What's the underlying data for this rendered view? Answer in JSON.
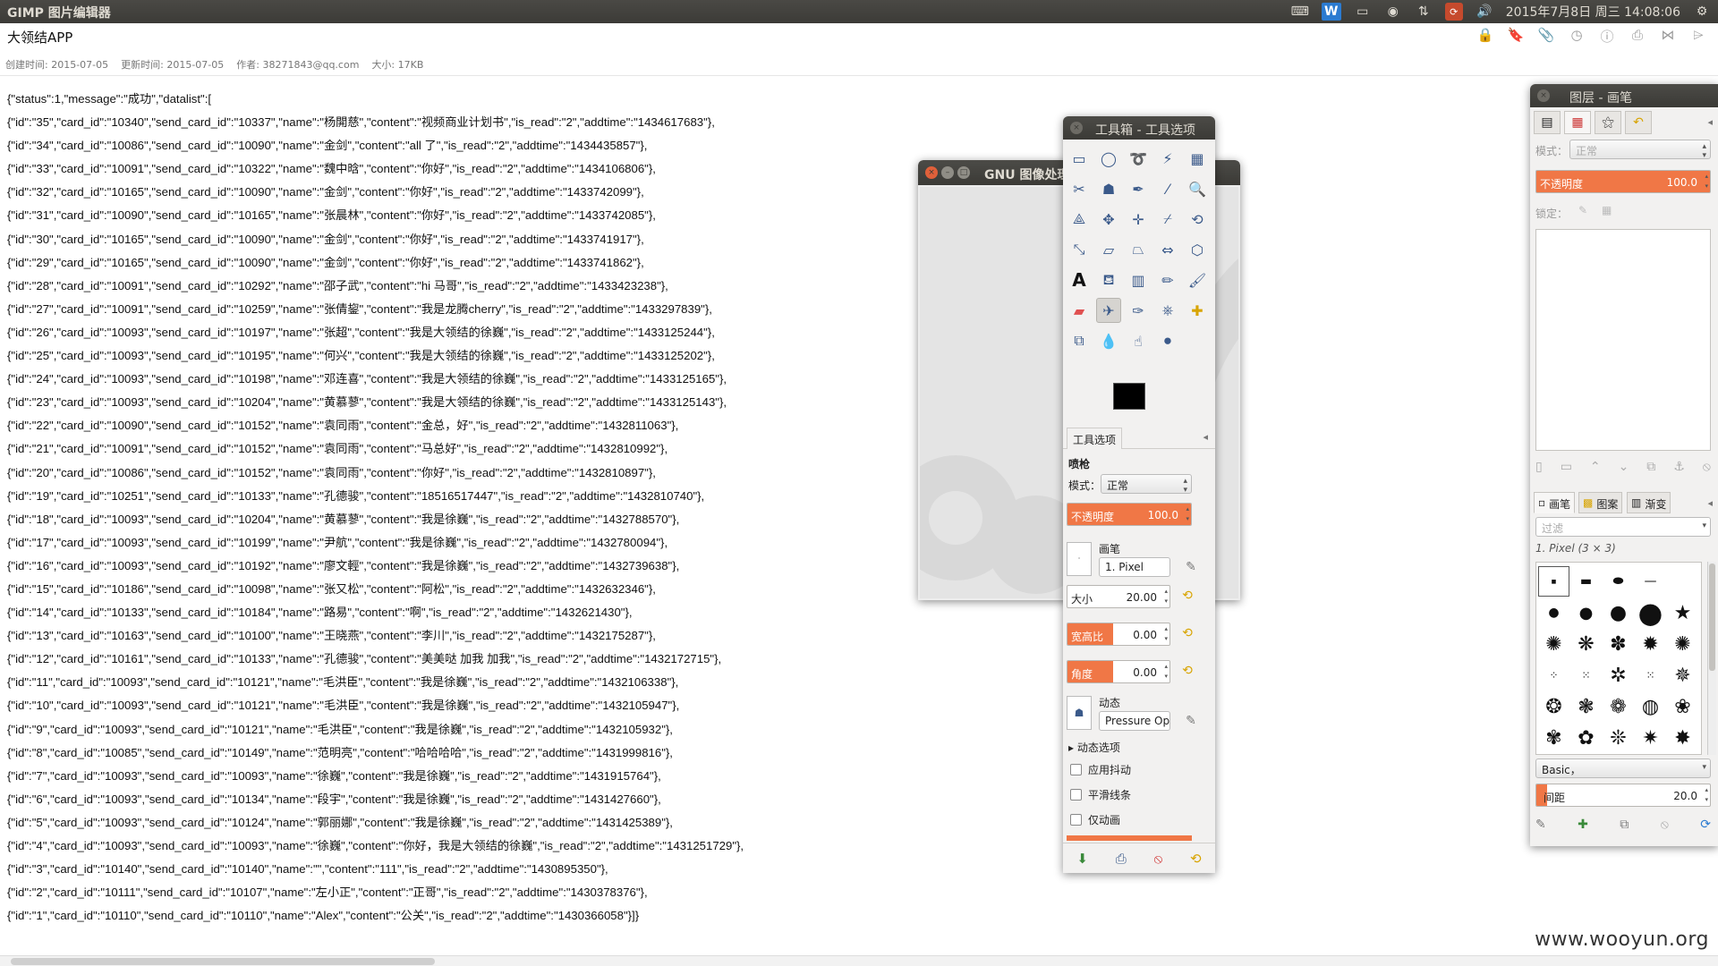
{
  "topbar": {
    "app_title": "GIMP 图片编辑器",
    "clock": "2015年7月8日 周三 14:08:06",
    "tray_icons": [
      "keyboard-icon",
      "wps-icon",
      "screen-icon",
      "chrome-icon",
      "network-arrows-icon",
      "update-icon",
      "volume-icon",
      "gear-icon"
    ]
  },
  "document": {
    "title": "大领结APP",
    "created": "创建时间: 2015-07-05",
    "updated": "更新时间: 2015-07-05",
    "author": "作者: 38271843@qq.com",
    "size": "大小: 17KB",
    "toolbar_icons": [
      "lock-icon",
      "bookmark-icon",
      "attach-icon",
      "clock-icon",
      "info-icon",
      "print-icon",
      "share-icon",
      "tag-icon"
    ]
  },
  "json_lines": [
    "{\"status\":1,\"message\":\"成功\",\"datalist\":[",
    "{\"id\":\"35\",\"card_id\":\"10340\",\"send_card_id\":\"10337\",\"name\":\"杨開慈\",\"content\":\"视频商业计划书\",\"is_read\":\"2\",\"addtime\":\"1434617683\"},",
    "{\"id\":\"34\",\"card_id\":\"10086\",\"send_card_id\":\"10090\",\"name\":\"金剑\",\"content\":\"all 了\",\"is_read\":\"2\",\"addtime\":\"1434435857\"},",
    "{\"id\":\"33\",\"card_id\":\"10091\",\"send_card_id\":\"10322\",\"name\":\"魏中晗\",\"content\":\"你好\",\"is_read\":\"2\",\"addtime\":\"1434106806\"},",
    "{\"id\":\"32\",\"card_id\":\"10165\",\"send_card_id\":\"10090\",\"name\":\"金剑\",\"content\":\"你好\",\"is_read\":\"2\",\"addtime\":\"1433742099\"},",
    "{\"id\":\"31\",\"card_id\":\"10090\",\"send_card_id\":\"10165\",\"name\":\"张晨林\",\"content\":\"你好\",\"is_read\":\"2\",\"addtime\":\"1433742085\"},",
    "{\"id\":\"30\",\"card_id\":\"10165\",\"send_card_id\":\"10090\",\"name\":\"金剑\",\"content\":\"你好\",\"is_read\":\"2\",\"addtime\":\"1433741917\"},",
    "{\"id\":\"29\",\"card_id\":\"10165\",\"send_card_id\":\"10090\",\"name\":\"金剑\",\"content\":\"你好\",\"is_read\":\"2\",\"addtime\":\"1433741862\"},",
    "{\"id\":\"28\",\"card_id\":\"10091\",\"send_card_id\":\"10292\",\"name\":\"邵子武\",\"content\":\"hi 马哥\",\"is_read\":\"2\",\"addtime\":\"1433423238\"},",
    "{\"id\":\"27\",\"card_id\":\"10091\",\"send_card_id\":\"10259\",\"name\":\"张倩鋆\",\"content\":\"我是龙腾cherry\",\"is_read\":\"2\",\"addtime\":\"1433297839\"},",
    "{\"id\":\"26\",\"card_id\":\"10093\",\"send_card_id\":\"10197\",\"name\":\"张超\",\"content\":\"我是大领结的徐巍\",\"is_read\":\"2\",\"addtime\":\"1433125244\"},",
    "{\"id\":\"25\",\"card_id\":\"10093\",\"send_card_id\":\"10195\",\"name\":\"何兴\",\"content\":\"我是大领结的徐巍\",\"is_read\":\"2\",\"addtime\":\"1433125202\"},",
    "{\"id\":\"24\",\"card_id\":\"10093\",\"send_card_id\":\"10198\",\"name\":\"邓连喜\",\"content\":\"我是大领结的徐巍\",\"is_read\":\"2\",\"addtime\":\"1433125165\"},",
    "{\"id\":\"23\",\"card_id\":\"10093\",\"send_card_id\":\"10204\",\"name\":\"黄慕蓼\",\"content\":\"我是大领结的徐巍\",\"is_read\":\"2\",\"addtime\":\"1433125143\"},",
    "{\"id\":\"22\",\"card_id\":\"10090\",\"send_card_id\":\"10152\",\"name\":\"袁同雨\",\"content\":\"金总，好\",\"is_read\":\"2\",\"addtime\":\"1432811063\"},",
    "{\"id\":\"21\",\"card_id\":\"10091\",\"send_card_id\":\"10152\",\"name\":\"袁同雨\",\"content\":\"马总好\",\"is_read\":\"2\",\"addtime\":\"1432810992\"},",
    "{\"id\":\"20\",\"card_id\":\"10086\",\"send_card_id\":\"10152\",\"name\":\"袁同雨\",\"content\":\"你好\",\"is_read\":\"2\",\"addtime\":\"1432810897\"},",
    "{\"id\":\"19\",\"card_id\":\"10251\",\"send_card_id\":\"10133\",\"name\":\"孔德骏\",\"content\":\"18516517447\",\"is_read\":\"2\",\"addtime\":\"1432810740\"},",
    "{\"id\":\"18\",\"card_id\":\"10093\",\"send_card_id\":\"10204\",\"name\":\"黄慕蓼\",\"content\":\"我是徐巍\",\"is_read\":\"2\",\"addtime\":\"1432788570\"},",
    "{\"id\":\"17\",\"card_id\":\"10093\",\"send_card_id\":\"10199\",\"name\":\"尹航\",\"content\":\"我是徐巍\",\"is_read\":\"2\",\"addtime\":\"1432780094\"},",
    "{\"id\":\"16\",\"card_id\":\"10093\",\"send_card_id\":\"10192\",\"name\":\"廖文輕\",\"content\":\"我是徐巍\",\"is_read\":\"2\",\"addtime\":\"1432739638\"},",
    "{\"id\":\"15\",\"card_id\":\"10186\",\"send_card_id\":\"10098\",\"name\":\"张又松\",\"content\":\"阿松\",\"is_read\":\"2\",\"addtime\":\"1432632346\"},",
    "{\"id\":\"14\",\"card_id\":\"10133\",\"send_card_id\":\"10184\",\"name\":\"路易\",\"content\":\"啊\",\"is_read\":\"2\",\"addtime\":\"1432621430\"},",
    "{\"id\":\"13\",\"card_id\":\"10163\",\"send_card_id\":\"10100\",\"name\":\"王晓燕\",\"content\":\"李川\",\"is_read\":\"2\",\"addtime\":\"1432175287\"},",
    "{\"id\":\"12\",\"card_id\":\"10161\",\"send_card_id\":\"10133\",\"name\":\"孔德骏\",\"content\":\"美美哒 加我 加我\",\"is_read\":\"2\",\"addtime\":\"1432172715\"},",
    "{\"id\":\"11\",\"card_id\":\"10093\",\"send_card_id\":\"10121\",\"name\":\"毛洪臣\",\"content\":\"我是徐巍\",\"is_read\":\"2\",\"addtime\":\"1432106338\"},",
    "{\"id\":\"10\",\"card_id\":\"10093\",\"send_card_id\":\"10121\",\"name\":\"毛洪臣\",\"content\":\"我是徐巍\",\"is_read\":\"2\",\"addtime\":\"1432105947\"},",
    "{\"id\":\"9\",\"card_id\":\"10093\",\"send_card_id\":\"10121\",\"name\":\"毛洪臣\",\"content\":\"我是徐巍\",\"is_read\":\"2\",\"addtime\":\"1432105932\"},",
    "{\"id\":\"8\",\"card_id\":\"10085\",\"send_card_id\":\"10149\",\"name\":\"范明亮\",\"content\":\"哈哈哈哈\",\"is_read\":\"2\",\"addtime\":\"1431999816\"},",
    "{\"id\":\"7\",\"card_id\":\"10093\",\"send_card_id\":\"10093\",\"name\":\"徐巍\",\"content\":\"我是徐巍\",\"is_read\":\"2\",\"addtime\":\"1431915764\"},",
    "{\"id\":\"6\",\"card_id\":\"10093\",\"send_card_id\":\"10134\",\"name\":\"段宇\",\"content\":\"我是徐巍\",\"is_read\":\"2\",\"addtime\":\"1431427660\"},",
    "{\"id\":\"5\",\"card_id\":\"10093\",\"send_card_id\":\"10124\",\"name\":\"郭丽娜\",\"content\":\"我是徐巍\",\"is_read\":\"2\",\"addtime\":\"1431425389\"},",
    "{\"id\":\"4\",\"card_id\":\"10093\",\"send_card_id\":\"10093\",\"name\":\"徐巍\",\"content\":\"你好，我是大领结的徐巍\",\"is_read\":\"2\",\"addtime\":\"1431251729\"},",
    "{\"id\":\"3\",\"card_id\":\"10140\",\"send_card_id\":\"10140\",\"name\":\"\",\"content\":\"111\",\"is_read\":\"2\",\"addtime\":\"1430895350\"},",
    "{\"id\":\"2\",\"card_id\":\"10111\",\"send_card_id\":\"10107\",\"name\":\"左小正\",\"content\":\"正哥\",\"is_read\":\"2\",\"addtime\":\"1430378376\"},",
    "{\"id\":\"1\",\"card_id\":\"10110\",\"send_card_id\":\"10110\",\"name\":\"Alex\",\"content\":\"公关\",\"is_read\":\"2\",\"addtime\":\"1430366058\"}]}"
  ],
  "gimp_main": {
    "title": "GNU 图像处理"
  },
  "toolbox": {
    "title": "工具箱 - 工具选项",
    "tool_options_tab": "工具选项",
    "tool_name": "喷枪",
    "mode_label": "模式：",
    "mode_value": "正常",
    "opacity": {
      "label": "不透明度",
      "value": "100.0",
      "fraction": 1.0
    },
    "brush_label": "画笔",
    "brush_value": "1. Pixel",
    "size": {
      "label": "大小",
      "value": "20.00",
      "fraction": 0.0
    },
    "aspect": {
      "label": "宽高比",
      "value": "0.00",
      "fraction": 0.45
    },
    "angle": {
      "label": "角度",
      "value": "0.00",
      "fraction": 0.45
    },
    "dynamics_label": "动态",
    "dynamics_value": "Pressure Opa",
    "dynamics_options": "动态选项",
    "apply_jitter": "应用抖动",
    "smooth_stroke": "平滑线条",
    "motion_only": "仅动画"
  },
  "dock": {
    "title": "图层 - 画笔",
    "mode_label": "模式：",
    "mode_value": "正常",
    "opacity": {
      "label": "不透明度",
      "value": "100.0"
    },
    "lock_label": "锁定：",
    "tabs": {
      "brushes": "画笔",
      "patterns": "图案",
      "gradients": "渐变"
    },
    "filter_placeholder": "过滤",
    "brush_name": "1. Pixel (3 × 3)",
    "preset_value": "Basic，",
    "spacing": {
      "label": "间距",
      "value": "20.0"
    }
  },
  "watermark": "www.wooyun.org"
}
